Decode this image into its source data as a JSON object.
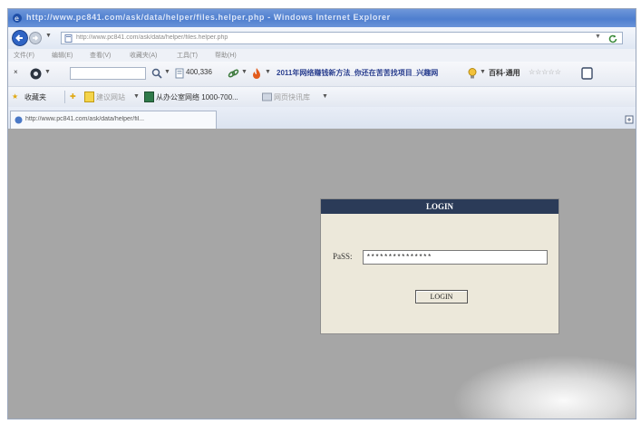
{
  "window": {
    "title": "http://www.pc841.com/ask/data/helper/files.helper.php - Windows Internet Explorer"
  },
  "addressbar": {
    "url": "http://www.pc841.com/ask/data/helper/files.helper.php"
  },
  "menu": {
    "items": [
      "文件(F)",
      "编辑(E)",
      "查看(V)",
      "收藏夹(A)",
      "工具(T)",
      "帮助(H)"
    ]
  },
  "toolbar": {
    "counter": "400,336",
    "promo": "2011年网络赚钱新方法_你还在苦苦找项目_兴趣网",
    "category": "百科·通用",
    "rating": "☆☆☆☆☆"
  },
  "favorites": {
    "label": "收藏夹",
    "suggested": "建议网站",
    "office": "从办公室网络 1000-700...",
    "slices": "网页快讯库"
  },
  "tab": {
    "label": "http://www.pc841.com/ask/data/helper/fil..."
  },
  "login": {
    "title": "LOGIN",
    "pass_label": "PaSS:",
    "pass_value": "***************",
    "button_label": "LOGIN"
  },
  "colors": {
    "login_header": "#2b3b58",
    "login_body": "#ece8da",
    "page_background": "#a6a6a6",
    "titlebar": "#4f7fcf"
  }
}
